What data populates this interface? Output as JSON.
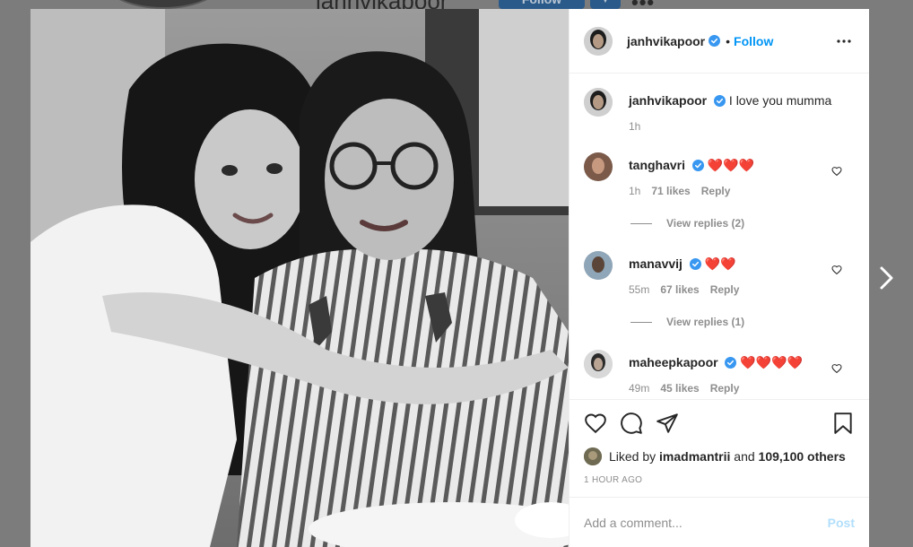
{
  "background": {
    "username": "janhvikapoor",
    "follow_label": "Follow"
  },
  "post": {
    "author": "janhvikapoor",
    "follow_label": "Follow",
    "caption_user": "janhvikapoor",
    "caption_text": "I love you mumma",
    "caption_time": "1h",
    "comments": [
      {
        "user": "tanghavri",
        "text": "❤️❤️❤️",
        "time": "1h",
        "likes": "71 likes",
        "reply": "Reply",
        "view_replies": "View replies (2)",
        "verified": true
      },
      {
        "user": "manavvij",
        "text": "❤️❤️",
        "time": "55m",
        "likes": "67 likes",
        "reply": "Reply",
        "view_replies": "View replies (1)",
        "verified": true
      },
      {
        "user": "maheepkapoor",
        "text": "❤️❤️❤️❤️",
        "time": "49m",
        "likes": "45 likes",
        "reply": "Reply",
        "view_replies": "",
        "verified": true
      }
    ],
    "liked_by_prefix": "Liked by",
    "liked_by_user": "imadmantrii",
    "liked_by_and": "and",
    "liked_by_others": "109,100 others",
    "timestamp": "1 HOUR AGO",
    "comment_placeholder": "Add a comment...",
    "post_label": "Post"
  },
  "colors": {
    "link": "#0095f6",
    "verified": "#3897f0",
    "muted": "#8e8e8e",
    "post_disabled": "#b2dffc"
  }
}
